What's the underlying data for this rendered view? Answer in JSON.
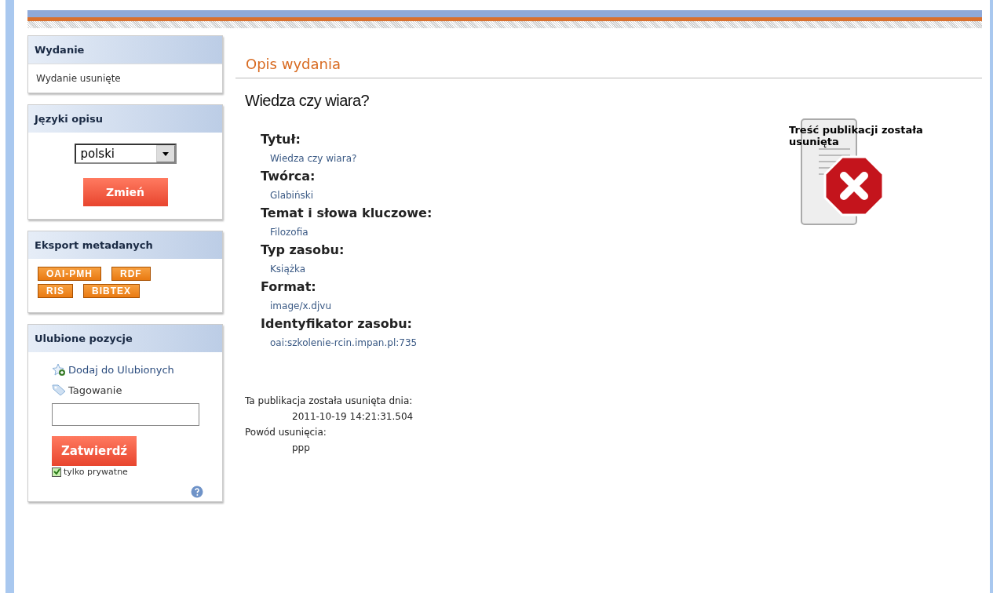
{
  "sidebar": [
    {
      "kind": "text",
      "title": "Wydanie",
      "text": "Wydanie usunięte"
    },
    {
      "kind": "language",
      "title": "Języki opisu",
      "select": "polski",
      "button": "Zmień"
    },
    {
      "kind": "export",
      "title": "Eksport metadanych",
      "buttons": [
        "OAI-PMH",
        "RDF",
        "RIS",
        "BIBTEX"
      ]
    },
    {
      "kind": "favorites",
      "title": "Ulubione pozycje",
      "add_link": "Dodaj do Ulubionych",
      "tag_label": "Tagowanie",
      "submit": "Zatwierdź",
      "private": {
        "label": "tylko prywatne",
        "checked": true
      }
    }
  ],
  "main": {
    "heading": "Opis wydania",
    "title": "Wiedza czy wiara?",
    "fields": [
      {
        "label": "Tytuł:",
        "value": "Wiedza czy wiara?"
      },
      {
        "label": "Twórca:",
        "value": "Glabiński"
      },
      {
        "label": "Temat i słowa kluczowe:",
        "value": "Filozofia"
      },
      {
        "label": "Typ zasobu:",
        "value": "Książka"
      },
      {
        "label": "Format:",
        "value": "image/x.djvu"
      },
      {
        "label": "Identyfikator zasobu:",
        "value": "oai:szkolenie-rcin.impan.pl:735"
      }
    ],
    "removed_notice": "Treść publikacji została usunięta",
    "deleted_label": "Ta publikacja została usunięta dnia:",
    "deleted_date": "2011-10-19 14:21:31.504",
    "reason_label": "Powód usunięcia:",
    "reason": "ppp"
  }
}
